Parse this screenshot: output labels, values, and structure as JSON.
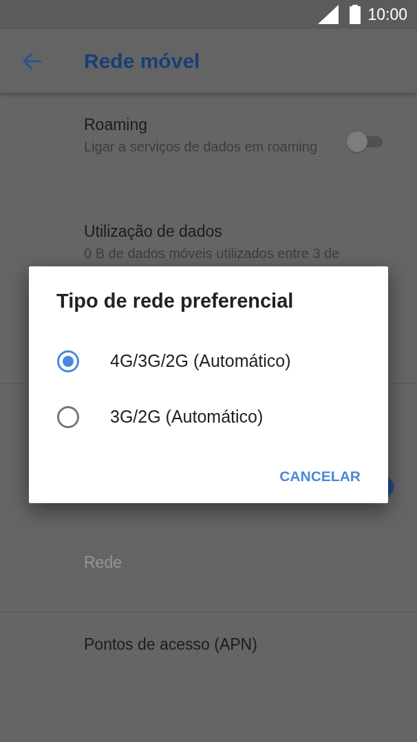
{
  "status_bar": {
    "time": "10:00"
  },
  "app_bar": {
    "title": "Rede móvel"
  },
  "sections": [
    {
      "items": [
        {
          "kind": "toggle",
          "title": "Roaming",
          "summary": "Ligar a serviços de dados em roaming",
          "on": false
        },
        {
          "kind": "text",
          "title": "Utilização de dados",
          "summary": "0 B de dados móveis utilizados entre 3 de"
        }
      ]
    },
    {
      "items": [
        {
          "kind": "toggle",
          "on": true
        },
        {
          "kind": "text",
          "title": "Rede",
          "disabled": true
        }
      ]
    },
    {
      "items": [
        {
          "kind": "text",
          "title": "Pontos de acesso (APN)"
        }
      ]
    }
  ],
  "dialog": {
    "title": "Tipo de rede preferencial",
    "options": [
      {
        "label": "4G/3G/2G (Automático)",
        "selected": true
      },
      {
        "label": "3G/2G (Automático)",
        "selected": false
      }
    ],
    "buttons": [
      "CANCELAR"
    ]
  }
}
